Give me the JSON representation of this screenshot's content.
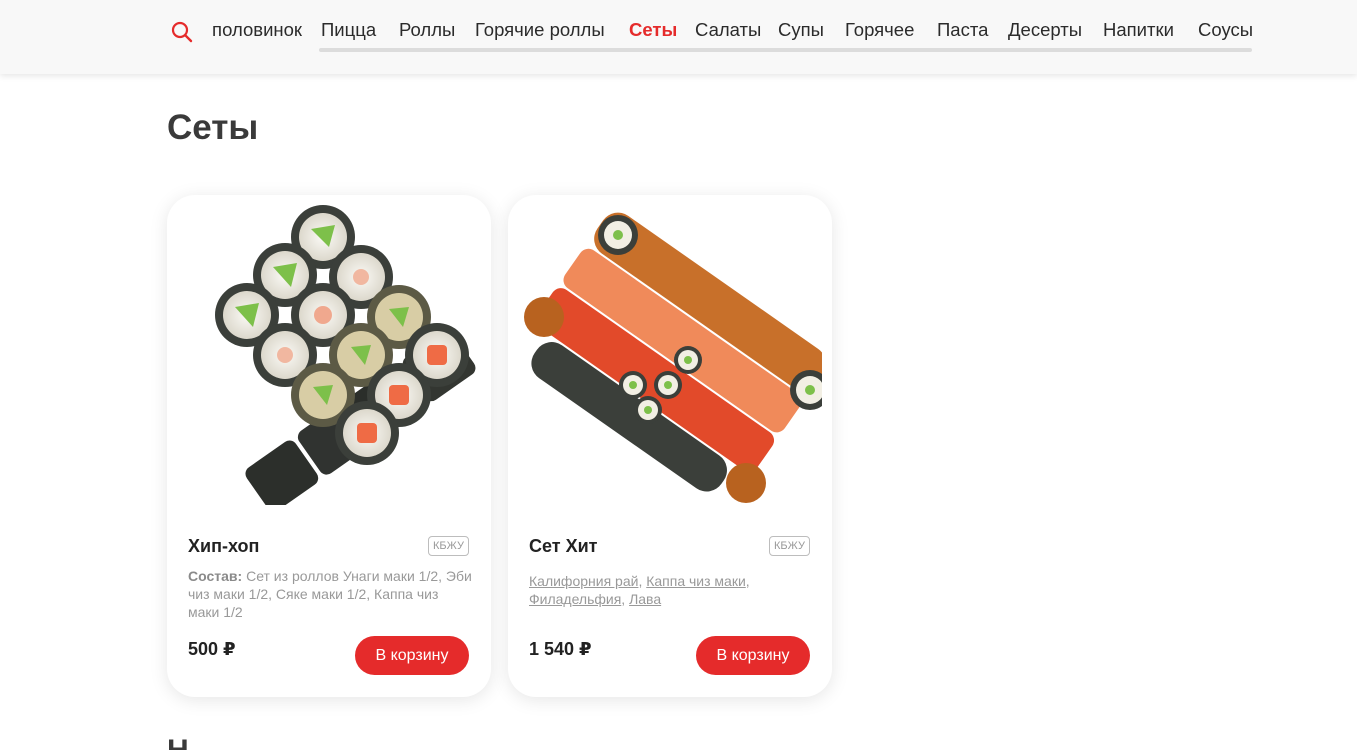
{
  "nav": {
    "partial_item": "половинок",
    "items": [
      {
        "label": "Пицца",
        "active": false
      },
      {
        "label": "Роллы",
        "active": false
      },
      {
        "label": "Горячие роллы",
        "active": false
      },
      {
        "label": "Сеты",
        "active": true
      },
      {
        "label": "Салаты",
        "active": false
      },
      {
        "label": "Супы",
        "active": false
      },
      {
        "label": "Горячее",
        "active": false
      },
      {
        "label": "Паста",
        "active": false
      },
      {
        "label": "Десерты",
        "active": false
      },
      {
        "label": "Напитки",
        "active": false
      },
      {
        "label": "Соусы",
        "active": false
      }
    ]
  },
  "colors": {
    "accent": "#e52b2b",
    "text": "#222222",
    "muted": "#999999"
  },
  "page_title": "Сеты",
  "products": [
    {
      "name": "Хип-хоп",
      "kbju_label": "КБЖУ",
      "desc_label": "Состав:",
      "desc_text": "Сет из роллов Унаги маки 1/2, Эби чиз маки 1/2, Сяке маки 1/2, Каппа чиз маки 1/2",
      "price": "500 ₽",
      "button_label": "В корзину"
    },
    {
      "name": "Сет Хит",
      "kbju_label": "КБЖУ",
      "links": [
        "Калифорния рай",
        "Каппа чиз маки",
        "Филадельфия",
        "Лава"
      ],
      "price": "1 540 ₽",
      "button_label": "В корзину"
    }
  ]
}
